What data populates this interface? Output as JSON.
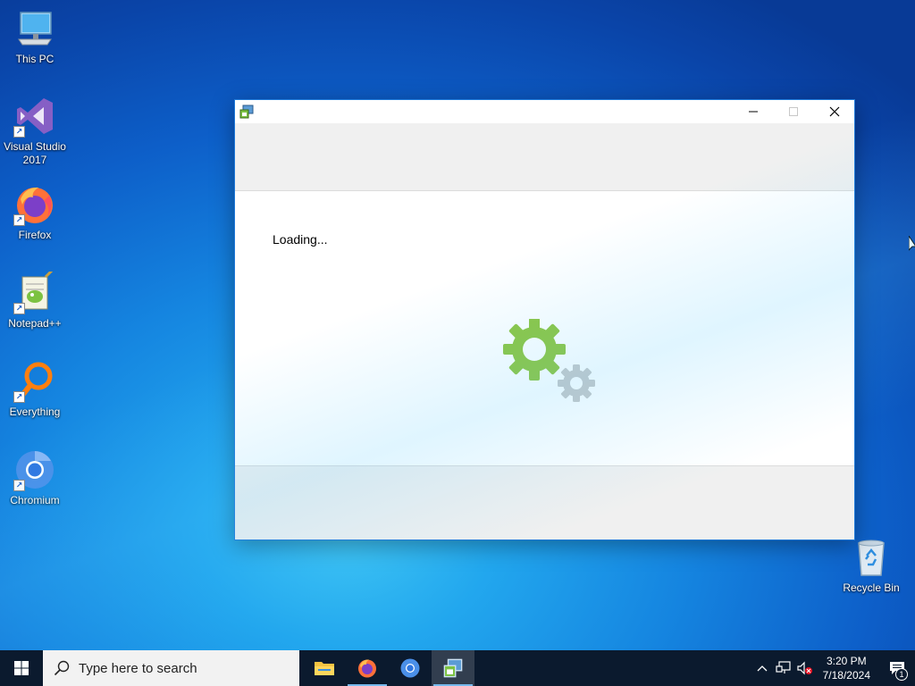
{
  "desktop": {
    "icons": [
      {
        "label": "This PC",
        "icon": "computer-icon"
      },
      {
        "label": "Visual Studio 2017",
        "icon": "visual-studio-icon"
      },
      {
        "label": "Firefox",
        "icon": "firefox-icon"
      },
      {
        "label": "Notepad++",
        "icon": "notepadpp-icon"
      },
      {
        "label": "Everything",
        "icon": "everything-search-icon"
      },
      {
        "label": "Chromium",
        "icon": "chromium-icon"
      },
      {
        "label": "Recycle Bin",
        "icon": "recycle-bin-icon"
      }
    ]
  },
  "window": {
    "title": "",
    "icon": "installer-app-icon",
    "loading_text": "Loading...",
    "buttons": {
      "minimize": "minimize-icon",
      "maximize": "maximize-icon",
      "close": "close-icon"
    }
  },
  "taskbar": {
    "search_placeholder": "Type here to search",
    "apps": [
      {
        "name": "File Explorer",
        "icon": "folder-icon",
        "running": false
      },
      {
        "name": "Firefox",
        "icon": "firefox-icon",
        "running": true
      },
      {
        "name": "Chromium",
        "icon": "chromium-icon",
        "running": false
      },
      {
        "name": "Installer",
        "icon": "installer-app-icon",
        "running": true,
        "active": true
      }
    ],
    "clock": {
      "time": "3:20 PM",
      "date": "7/18/2024"
    },
    "notification_count": "1"
  },
  "colors": {
    "gear_green": "#8dc63f",
    "gear_gray": "#c8c8c8",
    "window_border": "#1e78d8",
    "taskbar_bg": "#0b1a2e"
  }
}
